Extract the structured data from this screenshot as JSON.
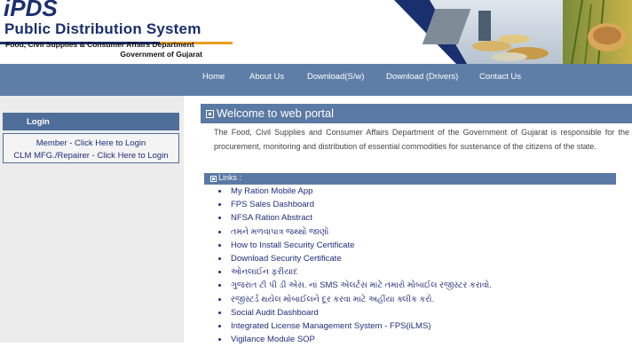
{
  "header": {
    "logo_text": "iPDS",
    "title": "Public Distribution System",
    "department": "Food, Civil Supplies & Consumer Affairs Department",
    "government": "Government of Gujarat"
  },
  "nav": {
    "items": [
      "Home",
      "About Us",
      "Download(S/w)",
      "Download (Drivers)",
      "Contact Us"
    ]
  },
  "login": {
    "heading": "Login",
    "member_link": "Member - Click Here to Login",
    "clm_link": "CLM MFG./Repairer - Click Here to Login"
  },
  "main": {
    "welcome": "Welcome to web portal",
    "intro": "The Food, Civil Supplies and Consumer Affairs Department of the Government of Gujarat is responsible for the procurement, monitoring and distribution of essential commodities for sustenance of the citizens of the state.",
    "links_heading": "Links :",
    "links": [
      "My Ration Mobile App",
      "FPS Sales Dashboard",
      "NFSA Ration Abstract",
      "તમને મળવાપાત્ર જથ્થો જાણો",
      "How to Install Security Certificate",
      "Download Security Certificate",
      "ઓનલાઈન ફરીયાદ",
      "ગુજરાત ટી પી ડી એસ. નાં SMS એલર્ટસ માટે તમારો મોબાઈલ રજીસ્ટર કરાવો.",
      "રજીસ્ટર્ડ થયેલ મોબાઈલને દૂર કરવા માટે અહીંયા ક્લીક કરો.",
      "Social Audit Dashboard",
      "Integrated License Management System - FPS(iLMS)",
      "Vigilance Module SOP"
    ]
  },
  "colors": {
    "nav_bg": "#5e7ea8",
    "bar_bg": "#5a79a4",
    "title_blue": "#1a2f6e",
    "link_blue": "#1f2d7a",
    "sidebar_bg": "#ececec"
  }
}
